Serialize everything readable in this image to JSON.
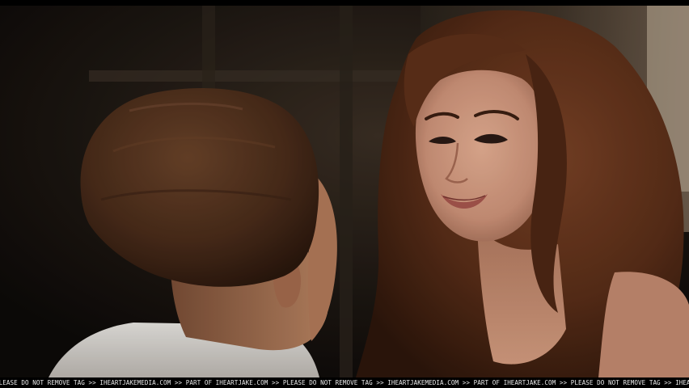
{
  "watermark": {
    "text": "PLEASE DO NOT REMOVE TAG >> IHEARTJAKEMEDIA.COM >> PART OF IHEARTJAKE.COM >> PLEASE DO NOT REMOVE TAG >> IHEARTJAKEMEDIA.COM >> PART OF IHEARTJAKE.COM >> PLEASE DO NOT REMOVE TAG >> IHEARTJAKEMEDIA.COM >> PART OF IHEARTJAKE.COM >> PLEASE DO NOT REMOVE TAG >> IHEARTJAKE"
  },
  "colors": {
    "background_dark": "#15110d",
    "window_light": "#6e5a45",
    "man_hair": "#4a2c1a",
    "man_skin": "#b97e5e",
    "shirt": "#dcd8d2",
    "woman_hair": "#5a2e18",
    "woman_skin": "#d49a7c",
    "lips": "#a8564e"
  }
}
